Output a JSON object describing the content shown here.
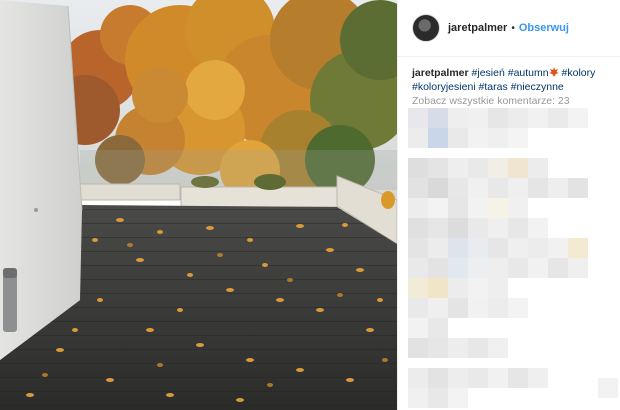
{
  "post": {
    "author": {
      "username": "jaretpalmer",
      "separator": "•",
      "follow_label": "Obserwuj",
      "avatar_icon": "profile-avatar"
    },
    "caption": {
      "username": "jaretpalmer",
      "hashtags_line1": [
        "#jesień",
        "#autumn",
        "#kolory"
      ],
      "hashtags_line2": [
        "#koloryjesieni",
        "#taras",
        "#nieczynne"
      ],
      "emoji_icon": "maple-leaf-icon"
    },
    "view_all_comments": "Zobacz wszystkie komentarze: 23",
    "comments_pixelated": true
  },
  "colors": {
    "link": "#3897f0",
    "hashtag": "#003569",
    "muted": "#999999",
    "text": "#262626"
  }
}
